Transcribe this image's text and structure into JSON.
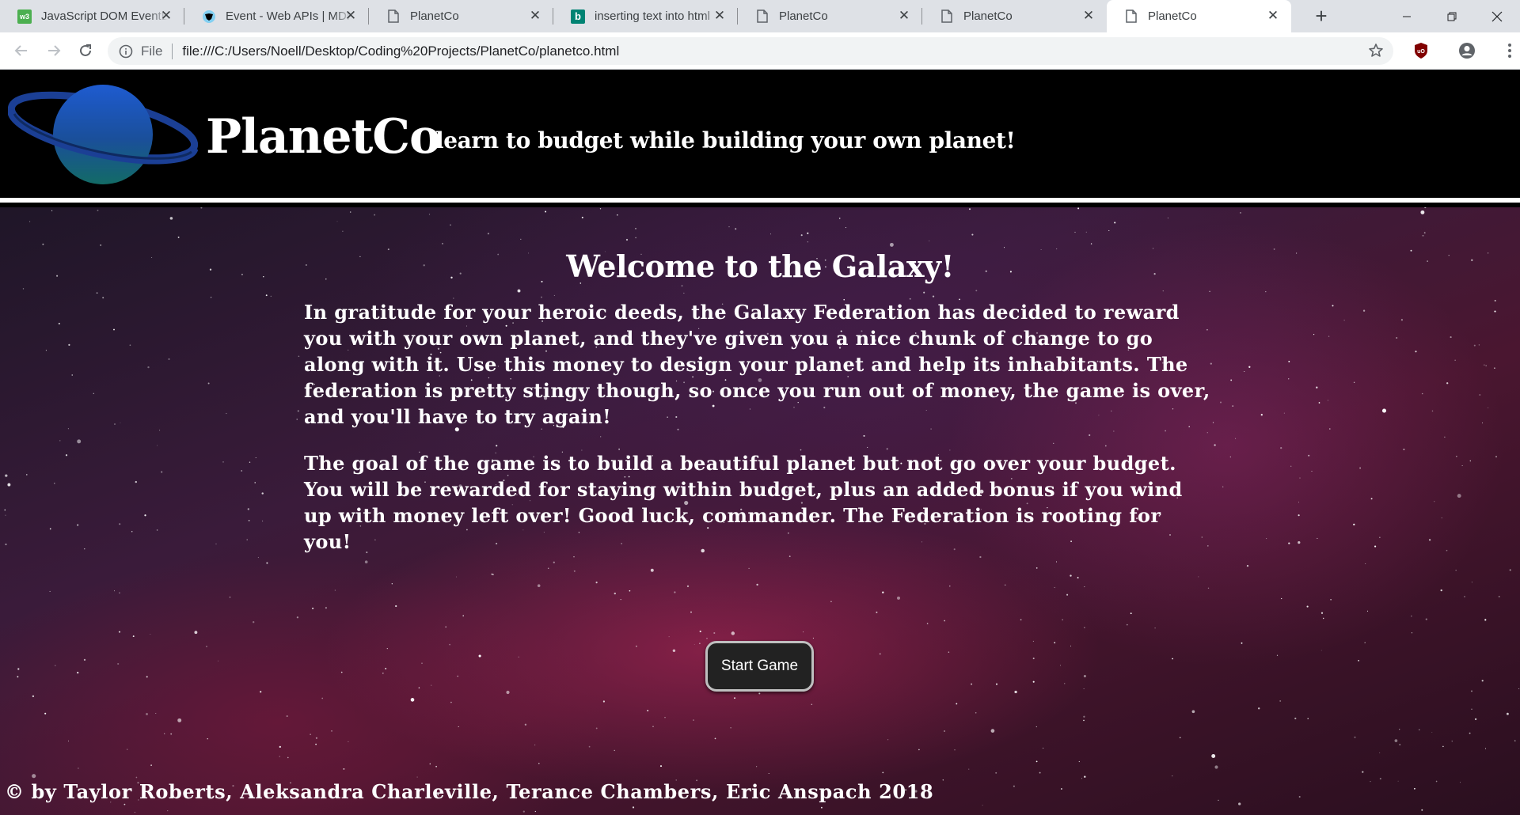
{
  "browser": {
    "tabs": [
      {
        "title": "JavaScript DOM EventL",
        "icon": "w3schools-icon"
      },
      {
        "title": "Event - Web APIs | MDN",
        "icon": "mdn-icon"
      },
      {
        "title": "PlanetCo",
        "icon": "page-icon"
      },
      {
        "title": "inserting text into html",
        "icon": "bing-icon"
      },
      {
        "title": "PlanetCo",
        "icon": "page-icon"
      },
      {
        "title": "PlanetCo",
        "icon": "page-icon"
      },
      {
        "title": "PlanetCo",
        "icon": "page-icon",
        "active": true
      }
    ],
    "address": {
      "scheme_label": "File",
      "url": "file:///C:/Users/Noell/Desktop/Coding%20Projects/PlanetCo/planetco.html"
    }
  },
  "header": {
    "brand": "PlanetCo",
    "tagline": "learn to budget while building your own planet!"
  },
  "main": {
    "title": "Welcome to the Galaxy!",
    "paragraphs": [
      "In gratitude for your heroic deeds, the Galaxy Federation has decided to reward you with your own planet, and they've given you a nice chunk of change to go along with it. Use this money to design your planet and help its inhabitants. The federation is pretty stingy though, so once you run out of money, the game is over, and you'll have to try again!",
      "The goal of the game is to build a beautiful planet but not go over your budget. You will be rewarded for staying within budget, plus an added bonus if you wind up with money left over! Good luck, commander. The Federation is rooting for you!"
    ],
    "start_button": "Start Game"
  },
  "footer": {
    "credits": "© by Taylor Roberts, Aleksandra Charleville, Terance Chambers, Eric Anspach 2018"
  },
  "colors": {
    "header_bg": "#000000",
    "button_bg": "#222222",
    "planet_blue": "#1e5bd0",
    "planet_teal": "#136b66"
  }
}
